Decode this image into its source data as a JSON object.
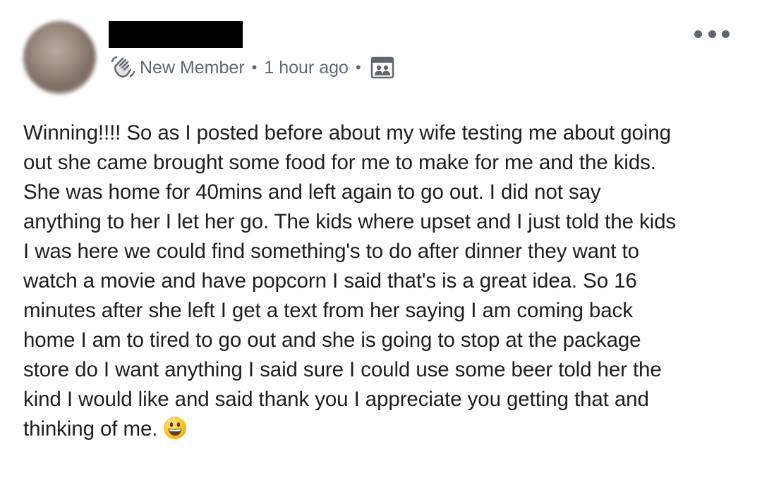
{
  "post": {
    "author": {
      "badge_label": "New Member",
      "badge_icon": "wave-hand-icon"
    },
    "timestamp": "1 hour ago",
    "separator": "•",
    "audience_icon": "group-audience-icon",
    "menu_icon": "more-options-icon",
    "body_lines": [
      "Winning!!!! So as I posted before about my wife testing me about going",
      "out she came brought some food for me to make for me and the kids.",
      "She was home for 40mins and left again to go out. I did not say",
      "anything to her I let her go. The kids where upset and I just told the kids",
      "I was here we could find something's to do after dinner they want to",
      "watch a movie and have popcorn I said that's is a great idea. So 16",
      "minutes after she left I get a text from her saying I am coming back",
      "home I am to tired to go out and she is going to stop at the package",
      "store do I want anything I said sure I could use some beer told her the",
      "kind I would like and said thank you I appreciate you getting that and",
      "thinking of me."
    ],
    "emoji_icon": "grinning-face-emoji",
    "colors": {
      "text": "#1c1e21",
      "meta": "#606770",
      "emoji_face": "#fbc02d"
    }
  }
}
